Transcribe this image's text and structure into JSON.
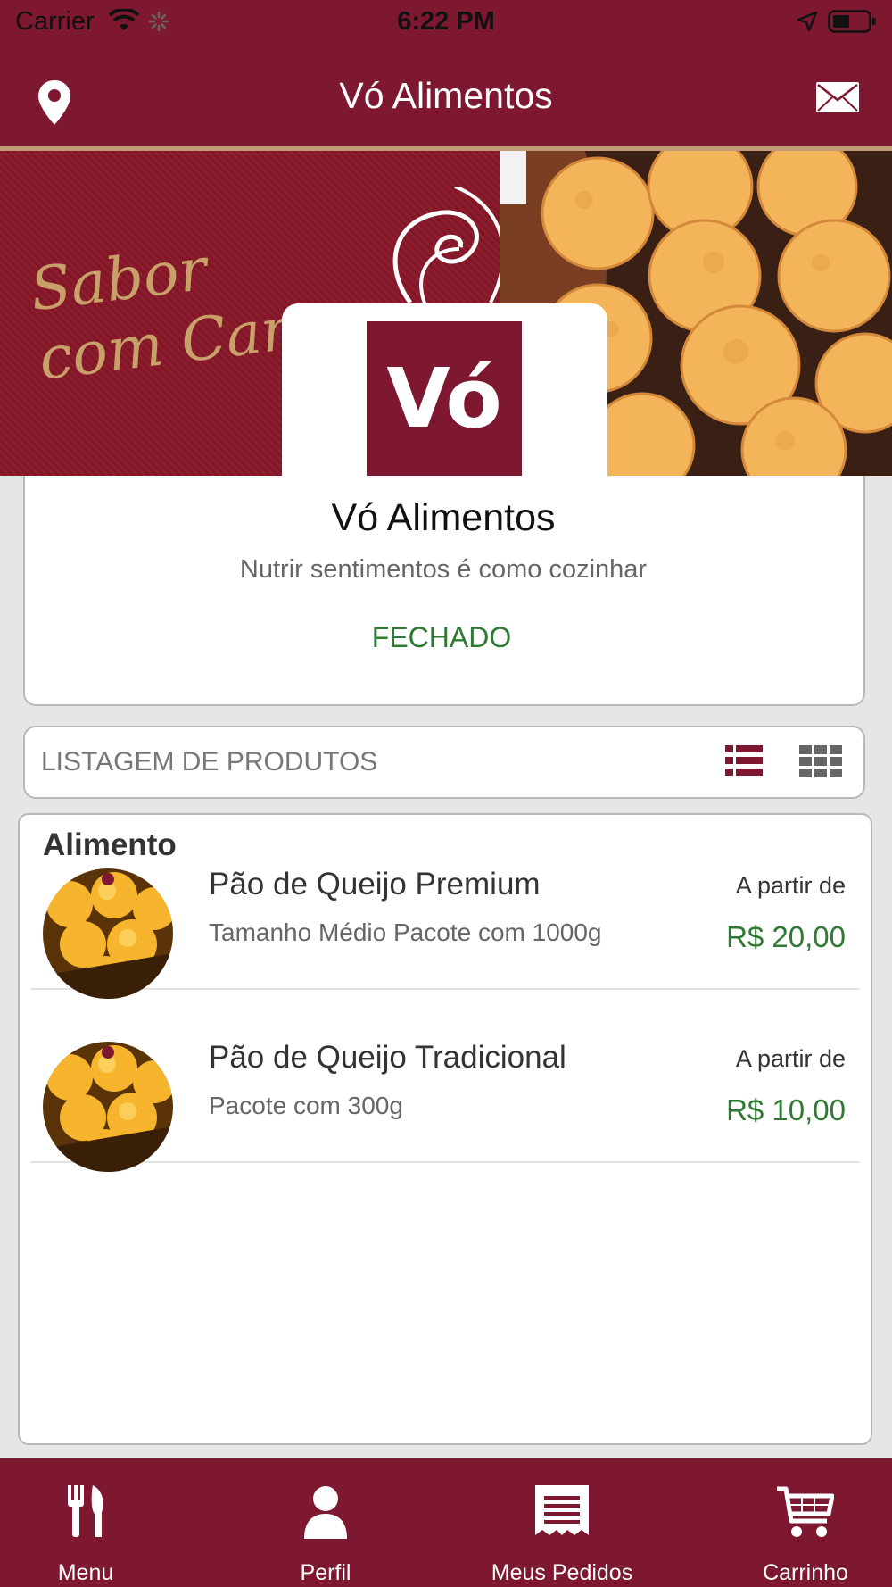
{
  "status_bar": {
    "carrier": "Carrier",
    "time": "6:22 PM"
  },
  "header": {
    "title": "Vó Alimentos",
    "left_icon": "map-pin-icon",
    "right_icon": "envelope-icon"
  },
  "banner": {
    "slogan_line1": "Sabor",
    "slogan_line2": "com Cari"
  },
  "store": {
    "logo_text": "Vó",
    "name": "Vó Alimentos",
    "tagline": "Nutrir sentimentos é como cozinhar",
    "status": "FECHADO"
  },
  "listing": {
    "label": "LISTAGEM DE PRODUTOS",
    "icons": [
      "list-view-icon",
      "grid-view-icon"
    ]
  },
  "category": {
    "title": "Alimento",
    "products": [
      {
        "name": "Pão de Queijo Premium",
        "description": "Tamanho Médio Pacote com 1000g",
        "from_label": "A partir de",
        "price": "R$ 20,00"
      },
      {
        "name": "Pão de Queijo Tradicional",
        "description": "Pacote com 300g",
        "from_label": "A partir de",
        "price": "R$ 10,00"
      }
    ]
  },
  "tabbar": {
    "items": [
      {
        "label": "Menu",
        "icon": "fork-knife-icon"
      },
      {
        "label": "Perfil",
        "icon": "user-icon"
      },
      {
        "label": "Meus Pedidos",
        "icon": "receipt-icon"
      },
      {
        "label": "Carrinho",
        "icon": "cart-icon"
      }
    ]
  },
  "colors": {
    "brand": "#7d1830",
    "accent_border": "#c29a75",
    "status_green": "#2e7a33",
    "background": "#e6e6e6"
  }
}
